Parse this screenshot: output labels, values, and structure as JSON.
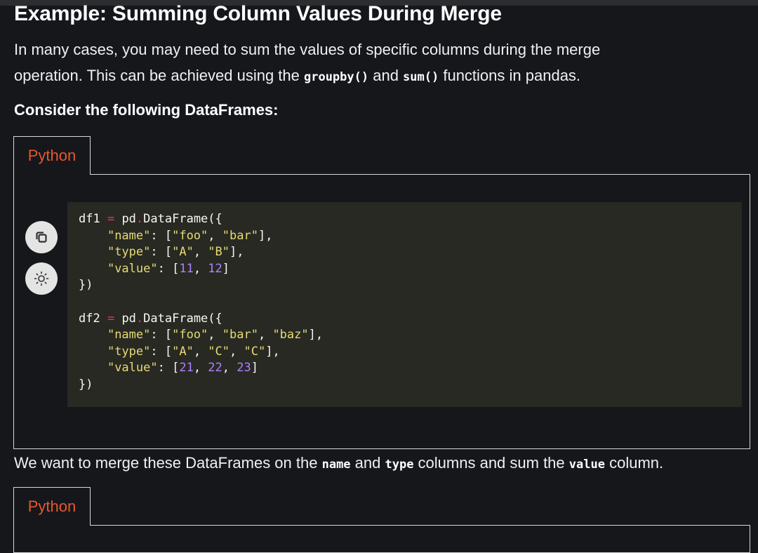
{
  "section": {
    "heading": "Example: Summing Column Values During Merge",
    "intro_line1": "In many cases, you may need to sum the values of specific columns during the merge",
    "intro_line2_a": "operation. This can be achieved using the ",
    "intro_code1": "groupby()",
    "intro_line2_b": " and ",
    "intro_code2": "sum()",
    "intro_line2_c": " functions in pandas.",
    "consider": "Consider the following DataFrames:"
  },
  "tabs": [
    {
      "label": "Python"
    },
    {
      "label": "Python"
    }
  ],
  "code_tools": {
    "copy_icon": "copy-icon",
    "theme_icon": "sun-icon"
  },
  "code_lines": [
    [
      {
        "t": "plain",
        "v": "df1 "
      },
      {
        "t": "op",
        "v": "="
      },
      {
        "t": "plain",
        "v": " pd"
      },
      {
        "t": "op",
        "v": "."
      },
      {
        "t": "plain",
        "v": "DataFrame({"
      }
    ],
    [
      {
        "t": "plain",
        "v": "    "
      },
      {
        "t": "str",
        "v": "\"name\""
      },
      {
        "t": "plain",
        "v": ": ["
      },
      {
        "t": "str",
        "v": "\"foo\""
      },
      {
        "t": "plain",
        "v": ", "
      },
      {
        "t": "str",
        "v": "\"bar\""
      },
      {
        "t": "plain",
        "v": "],"
      }
    ],
    [
      {
        "t": "plain",
        "v": "    "
      },
      {
        "t": "str",
        "v": "\"type\""
      },
      {
        "t": "plain",
        "v": ": ["
      },
      {
        "t": "str",
        "v": "\"A\""
      },
      {
        "t": "plain",
        "v": ", "
      },
      {
        "t": "str",
        "v": "\"B\""
      },
      {
        "t": "plain",
        "v": "],"
      }
    ],
    [
      {
        "t": "plain",
        "v": "    "
      },
      {
        "t": "str",
        "v": "\"value\""
      },
      {
        "t": "plain",
        "v": ": ["
      },
      {
        "t": "num",
        "v": "11"
      },
      {
        "t": "plain",
        "v": ", "
      },
      {
        "t": "num",
        "v": "12"
      },
      {
        "t": "plain",
        "v": "]"
      }
    ],
    [
      {
        "t": "plain",
        "v": "})"
      }
    ],
    [],
    [
      {
        "t": "plain",
        "v": "df2 "
      },
      {
        "t": "op",
        "v": "="
      },
      {
        "t": "plain",
        "v": " pd"
      },
      {
        "t": "op",
        "v": "."
      },
      {
        "t": "plain",
        "v": "DataFrame({"
      }
    ],
    [
      {
        "t": "plain",
        "v": "    "
      },
      {
        "t": "str",
        "v": "\"name\""
      },
      {
        "t": "plain",
        "v": ": ["
      },
      {
        "t": "str",
        "v": "\"foo\""
      },
      {
        "t": "plain",
        "v": ", "
      },
      {
        "t": "str",
        "v": "\"bar\""
      },
      {
        "t": "plain",
        "v": ", "
      },
      {
        "t": "str",
        "v": "\"baz\""
      },
      {
        "t": "plain",
        "v": "],"
      }
    ],
    [
      {
        "t": "plain",
        "v": "    "
      },
      {
        "t": "str",
        "v": "\"type\""
      },
      {
        "t": "plain",
        "v": ": ["
      },
      {
        "t": "str",
        "v": "\"A\""
      },
      {
        "t": "plain",
        "v": ", "
      },
      {
        "t": "str",
        "v": "\"C\""
      },
      {
        "t": "plain",
        "v": ", "
      },
      {
        "t": "str",
        "v": "\"C\""
      },
      {
        "t": "plain",
        "v": "],"
      }
    ],
    [
      {
        "t": "plain",
        "v": "    "
      },
      {
        "t": "str",
        "v": "\"value\""
      },
      {
        "t": "plain",
        "v": ": ["
      },
      {
        "t": "num",
        "v": "21"
      },
      {
        "t": "plain",
        "v": ", "
      },
      {
        "t": "num",
        "v": "22"
      },
      {
        "t": "plain",
        "v": ", "
      },
      {
        "t": "num",
        "v": "23"
      },
      {
        "t": "plain",
        "v": "]"
      }
    ],
    [
      {
        "t": "plain",
        "v": "})"
      }
    ]
  ],
  "after": {
    "text_a": "We want to merge these DataFrames on the ",
    "code_a": "name",
    "text_b": " and ",
    "code_b": "type",
    "text_c": " columns and sum the ",
    "code_c": "value",
    "text_d": " column."
  },
  "colors": {
    "background": "#16171b",
    "tab_label": "#e8572f",
    "code_background": "#282923",
    "string": "#e6db74",
    "number": "#ae81ff",
    "operator": "#f92672"
  }
}
